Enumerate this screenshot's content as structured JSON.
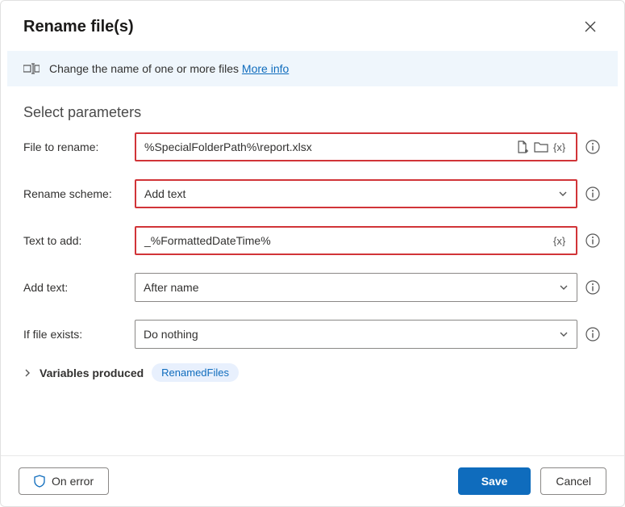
{
  "dialog": {
    "title": "Rename file(s)",
    "description_prefix": "Change the name of one or more files ",
    "more_info": "More info"
  },
  "section_title": "Select parameters",
  "fields": {
    "file_to_rename": {
      "label": "File to rename:",
      "value": "%SpecialFolderPath%\\report.xlsx"
    },
    "rename_scheme": {
      "label": "Rename scheme:",
      "value": "Add text"
    },
    "text_to_add": {
      "label": "Text to add:",
      "value": "_%FormattedDateTime%"
    },
    "add_text": {
      "label": "Add text:",
      "value": "After name"
    },
    "if_file_exists": {
      "label": "If file exists:",
      "value": "Do nothing"
    }
  },
  "variables": {
    "toggle_label": "Variables produced",
    "badge": "RenamedFiles"
  },
  "footer": {
    "on_error": "On error",
    "save": "Save",
    "cancel": "Cancel"
  }
}
